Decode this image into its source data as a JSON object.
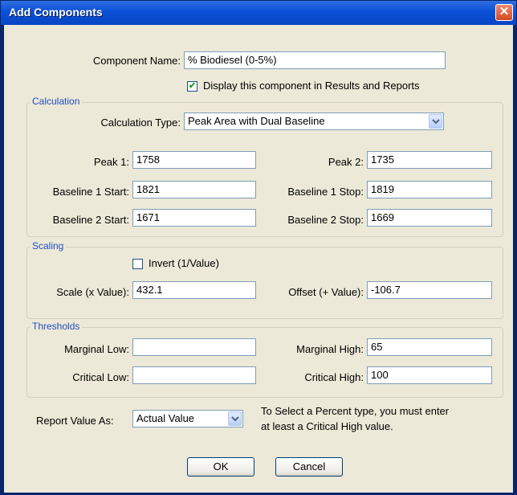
{
  "window": {
    "title": "Add Components",
    "close_label": "✕"
  },
  "component_name": {
    "label": "Component Name:",
    "value": "% Biodiesel (0-5%)"
  },
  "display_check": {
    "label": "Display this component in Results and Reports",
    "checked": true
  },
  "calculation": {
    "legend": "Calculation",
    "type_label": "Calculation Type:",
    "type_value": "Peak Area with Dual Baseline",
    "peak1": {
      "label": "Peak 1:",
      "value": "1758"
    },
    "peak2": {
      "label": "Peak 2:",
      "value": "1735"
    },
    "b1start": {
      "label": "Baseline 1 Start:",
      "value": "1821"
    },
    "b1stop": {
      "label": "Baseline 1 Stop:",
      "value": "1819"
    },
    "b2start": {
      "label": "Baseline 2 Start:",
      "value": "1671"
    },
    "b2stop": {
      "label": "Baseline 2 Stop:",
      "value": "1669"
    }
  },
  "scaling": {
    "legend": "Scaling",
    "invert_label": "Invert (1/Value)",
    "invert_checked": false,
    "scale": {
      "label": "Scale (x Value):",
      "value": "432.1"
    },
    "offset": {
      "label": "Offset (+ Value):",
      "value": "-106.7"
    }
  },
  "thresholds": {
    "legend": "Thresholds",
    "marginal_low": {
      "label": "Marginal Low:",
      "value": ""
    },
    "marginal_high": {
      "label": "Marginal High:",
      "value": "65"
    },
    "critical_low": {
      "label": "Critical Low:",
      "value": ""
    },
    "critical_high": {
      "label": "Critical High:",
      "value": "100"
    }
  },
  "report": {
    "label": "Report Value As:",
    "value": "Actual Value",
    "note_line1": "To Select a Percent type, you must enter",
    "note_line2": "at least a Critical High value."
  },
  "buttons": {
    "ok": "OK",
    "cancel": "Cancel"
  }
}
